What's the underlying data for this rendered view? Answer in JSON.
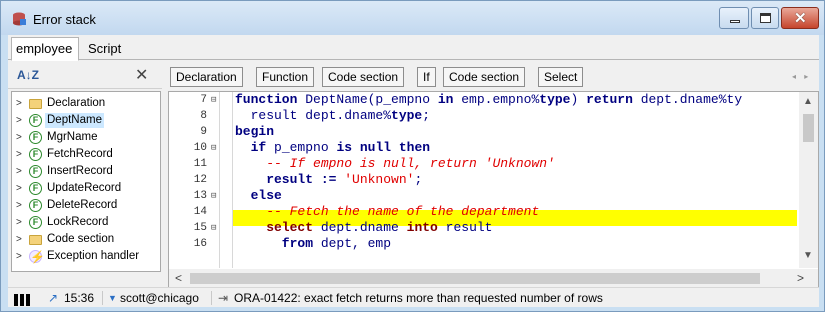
{
  "window": {
    "title": "Error stack",
    "icons": {
      "app": "database-stack-icon",
      "minimize": "minimize-icon",
      "maximize": "maximize-icon",
      "close": "close-icon"
    }
  },
  "tabs": [
    {
      "label": "employee",
      "active": true
    },
    {
      "label": "Script",
      "active": false
    }
  ],
  "left_panel": {
    "sort_icon": "A↓Z",
    "close_glyph": "✕",
    "tree": [
      {
        "label": "Declaration",
        "icon": "folder-icon"
      },
      {
        "label": "DeptName",
        "icon": "function-icon",
        "selected": true
      },
      {
        "label": "MgrName",
        "icon": "function-icon"
      },
      {
        "label": "FetchRecord",
        "icon": "function-icon"
      },
      {
        "label": "InsertRecord",
        "icon": "function-icon"
      },
      {
        "label": "UpdateRecord",
        "icon": "function-icon"
      },
      {
        "label": "DeleteRecord",
        "icon": "function-icon"
      },
      {
        "label": "LockRecord",
        "icon": "function-icon"
      },
      {
        "label": "Code section",
        "icon": "folder-icon"
      },
      {
        "label": "Exception handler",
        "icon": "exception-icon"
      }
    ]
  },
  "breadcrumbs": [
    "Declaration",
    "Function",
    "Code section",
    "If",
    "Code section",
    "Select"
  ],
  "editor": {
    "lines": [
      {
        "n": "7",
        "fold": "⊟"
      },
      {
        "n": "8",
        "fold": ""
      },
      {
        "n": "9",
        "fold": ""
      },
      {
        "n": "10",
        "fold": "⊟"
      },
      {
        "n": "11",
        "fold": ""
      },
      {
        "n": "12",
        "fold": ""
      },
      {
        "n": "13",
        "fold": "⊟"
      },
      {
        "n": "14",
        "fold": ""
      },
      {
        "n": "15",
        "fold": "⊟"
      },
      {
        "n": "16",
        "fold": ""
      }
    ],
    "code": {
      "l7a": "function ",
      "l7b": "DeptName(p_empno ",
      "l7c": "in ",
      "l7d": "emp.empno%",
      "l7e": "type",
      "l7f": ") ",
      "l7g": "return ",
      "l7h": "dept.dname%ty",
      "l8a": "  result dept.dname%",
      "l8b": "type",
      "l8c": ";",
      "l9a": "begin",
      "l10a": "  if ",
      "l10b": "p_empno ",
      "l10c": "is null then",
      "l11a": "    -- If empno is null, return 'Unknown'",
      "l12a": "    result := ",
      "l12b": "'Unknown'",
      "l12c": ";",
      "l13a": "  else",
      "l14a": "    -- Fetch the name of the department",
      "l15a": "    select ",
      "l15b": "dept.dname ",
      "l15c": "into ",
      "l15d": "result",
      "l16a": "      from ",
      "l16b": "dept, emp"
    },
    "highlight_line": "15"
  },
  "status": {
    "time": "15:36",
    "connection": "scott@chicago",
    "message": "ORA-01422: exact fetch returns more than requested number of rows"
  }
}
